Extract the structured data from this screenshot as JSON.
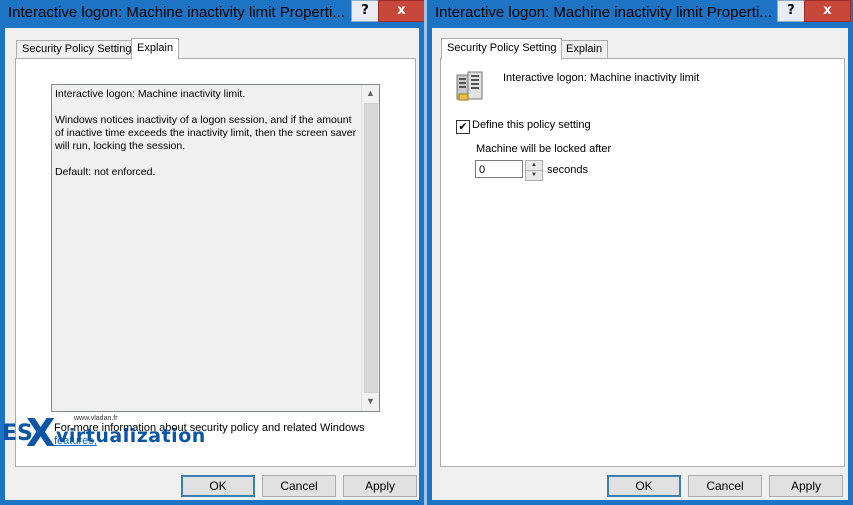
{
  "left_dialog": {
    "title": "Interactive logon: Machine inactivity limit Properti...",
    "help_label": "?",
    "close_label": "x",
    "tabs": [
      {
        "label": "Security Policy Setting",
        "active": false
      },
      {
        "label": "Explain",
        "active": true
      }
    ],
    "explain": {
      "heading": "Interactive logon: Machine inactivity limit.",
      "body": "Windows notices inactivity of a logon session, and if the amount of inactive time exceeds the inactivity limit, then the screen saver will run, locking the session.",
      "default": "Default: not enforced."
    },
    "more_info_prefix": "For more information about security policy and related Windows",
    "more_info_link": "features,",
    "watermark": {
      "es": "ES",
      "x": "X",
      "rest": "virtualization",
      "url": "www.vladan.fr"
    },
    "buttons": {
      "ok": "OK",
      "cancel": "Cancel",
      "apply": "Apply"
    }
  },
  "right_dialog": {
    "title": "Interactive logon: Machine inactivity limit Properti...",
    "help_label": "?",
    "close_label": "x",
    "tabs": [
      {
        "label": "Security Policy Setting",
        "active": true
      },
      {
        "label": "Explain",
        "active": false
      }
    ],
    "policy_name": "Interactive logon: Machine inactivity limit",
    "define_checkbox": {
      "label": "Define this policy setting",
      "checked": true,
      "mark": "✔"
    },
    "lock_label": "Machine will be locked after",
    "value": "0",
    "unit": "seconds",
    "buttons": {
      "ok": "OK",
      "cancel": "Cancel",
      "apply": "Apply"
    }
  },
  "colors": {
    "title_bar": "#1e74c4",
    "close_button": "#c7473b",
    "dialog_bg": "#f0f0f0",
    "link": "#0066cc",
    "watermark": "#0a55a6"
  },
  "icons": {
    "close": "close-icon",
    "help": "help-icon",
    "policy": "server-policy-icon",
    "scroll_up": "chevron-up-icon",
    "scroll_down": "chevron-down-icon"
  }
}
